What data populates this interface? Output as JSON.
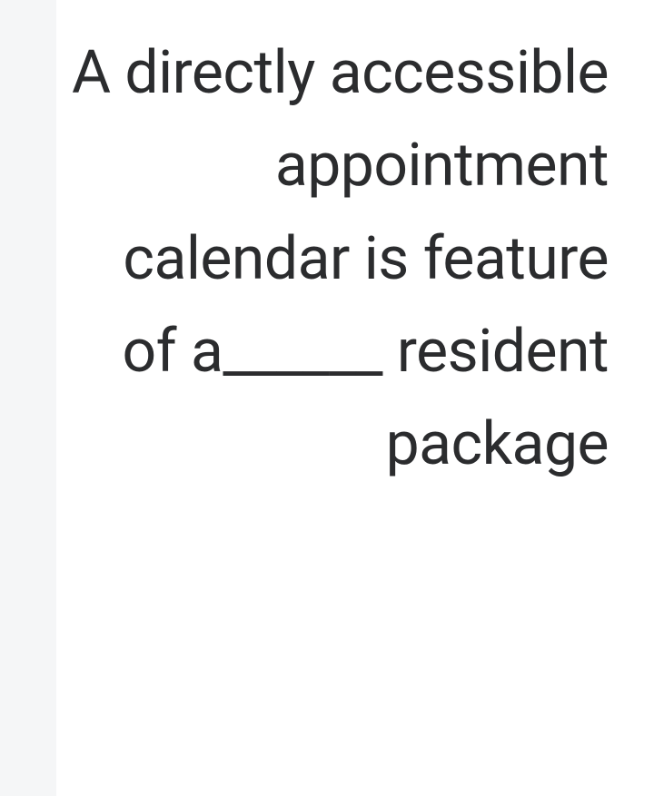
{
  "question": {
    "text": "A directly accessible appointment calendar is feature of a______ resident package"
  }
}
